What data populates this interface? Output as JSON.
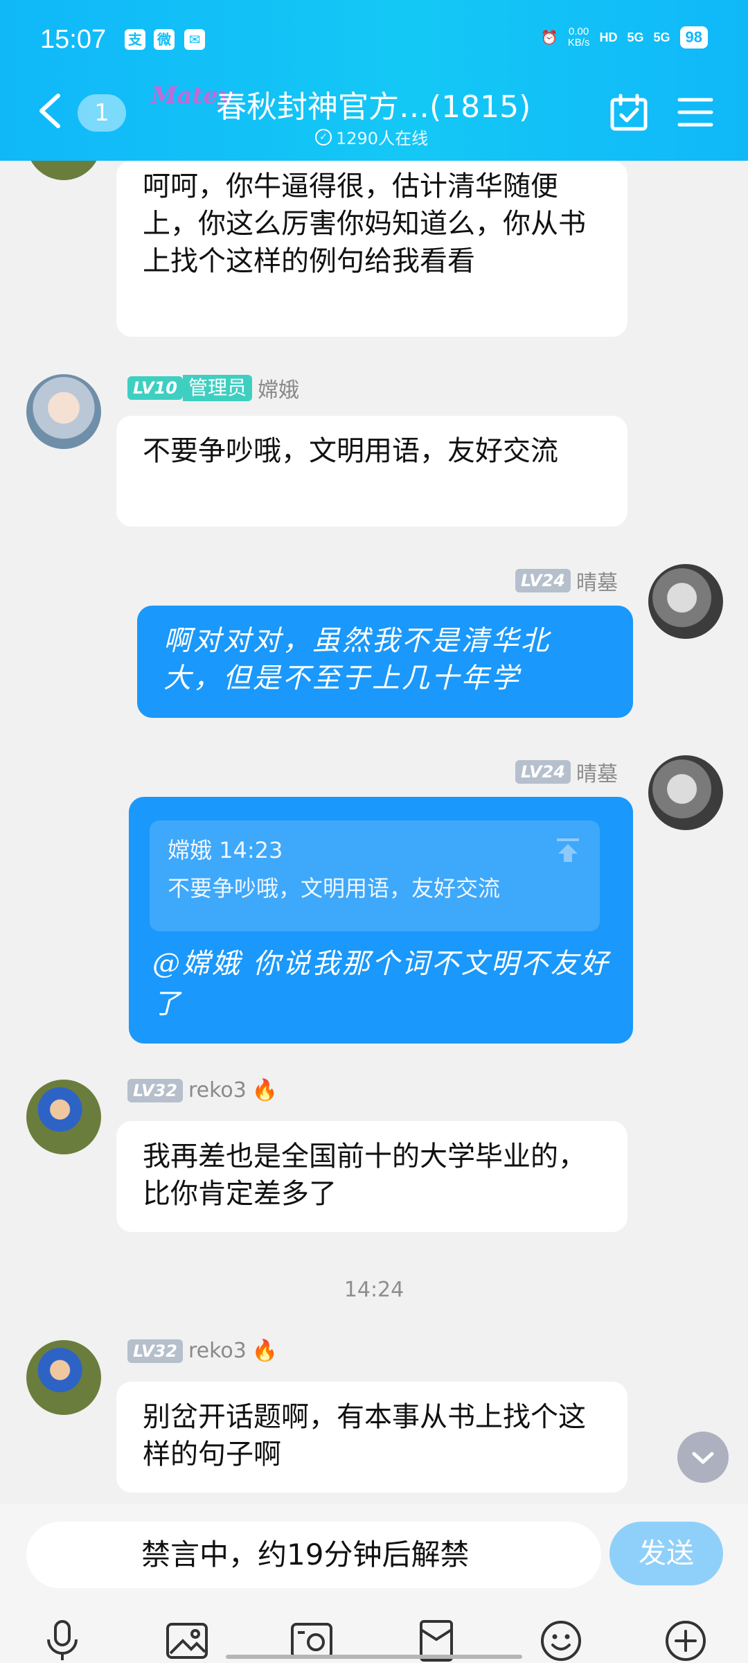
{
  "status_bar": {
    "time": "15:07",
    "net_speed_top": "0.00",
    "net_speed_unit": "KB/s",
    "signal_1": "5G",
    "signal_2": "5G",
    "battery": "98"
  },
  "header": {
    "unread_count": "1",
    "logo_text": "Matey",
    "title": "春秋封神官方…(1815)",
    "online_text": "1290人在线"
  },
  "messages": [
    {
      "side": "left",
      "text": "呵呵，你牛逼得很，估计清华随便上，你这么厉害你妈知道么，你从书上找个这样的例句给我看看"
    },
    {
      "side": "left",
      "level": "LV10",
      "role": "管理员",
      "sender": "嫦娥",
      "text": "不要争吵哦，文明用语，友好交流"
    },
    {
      "side": "right",
      "level": "LV24",
      "sender": "晴墓",
      "text": "啊对对对，虽然我不是清华北大，但是不至于上几十年学"
    },
    {
      "side": "right",
      "level": "LV24",
      "sender": "晴墓",
      "quote_head": "嫦娥 14:23",
      "quote_body": "不要争吵哦，文明用语，友好交流",
      "text": "@嫦娥 你说我那个词不文明不友好了"
    },
    {
      "side": "left",
      "level": "LV32",
      "sender": "reko3",
      "text": "我再差也是全国前十的大学毕业的，比你肯定差多了"
    },
    {
      "side": "left",
      "level": "LV32",
      "sender": "reko3",
      "text": "别岔开话题啊，有本事从书上找个这样的句子啊"
    }
  ],
  "time_separator": "14:24",
  "input": {
    "muted_text": "禁言中，约19分钟后解禁",
    "send_label": "发送"
  },
  "colors": {
    "header_gradient": "#10b8f8",
    "right_bubble": "#1a98fb",
    "admin_badge": "#3ecfc1",
    "level_badge": "#b6bfcc",
    "send_button": "#8fd0fb"
  }
}
